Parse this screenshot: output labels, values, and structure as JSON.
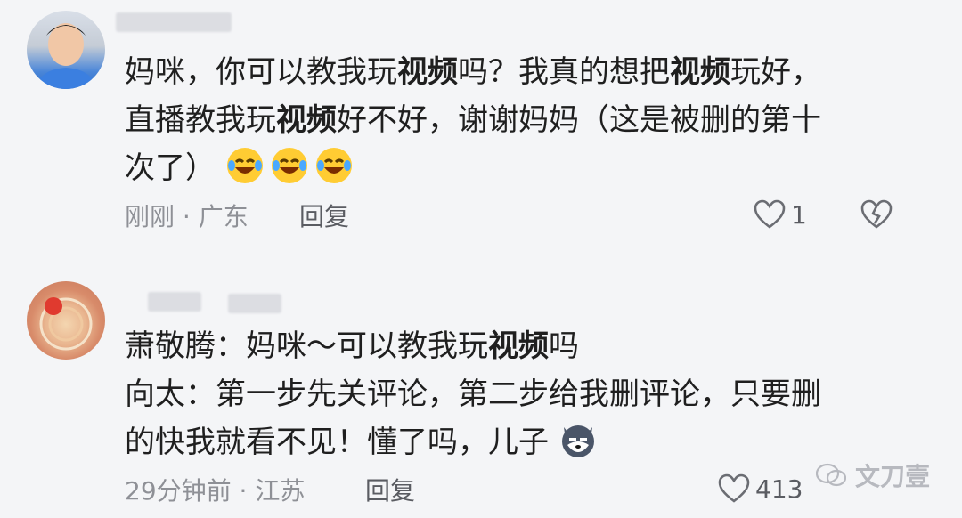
{
  "comments": [
    {
      "lines": [
        {
          "a": "妈咪，你可以教我玩",
          "kw": "视频",
          "b": "吗？我真的想把",
          "kw2": "视频",
          "c": "玩好，"
        },
        {
          "a": "直播教我玩",
          "kw": "视频",
          "b": "好不好，谢谢妈妈（这是被删的第十"
        },
        {
          "a": "次了）"
        }
      ],
      "time": "刚刚",
      "location": "广东",
      "reply": "回复",
      "likes": "1"
    },
    {
      "lines": [
        {
          "a": "萧敬腾：妈咪～可以教我玩",
          "kw": "视频",
          "b": "吗"
        },
        {
          "a": "向太：第一步先关评论，第二步给我删评论，只要删"
        },
        {
          "a": "的快我就看不见！懂了吗，儿子"
        }
      ],
      "time": "29分钟前",
      "location": "江苏",
      "reply": "回复",
      "likes": "413"
    }
  ],
  "watermark": "文刀壹",
  "colors": {
    "bg": "#f4f5f7",
    "text": "#1f1f1f",
    "meta": "#8e9096"
  }
}
